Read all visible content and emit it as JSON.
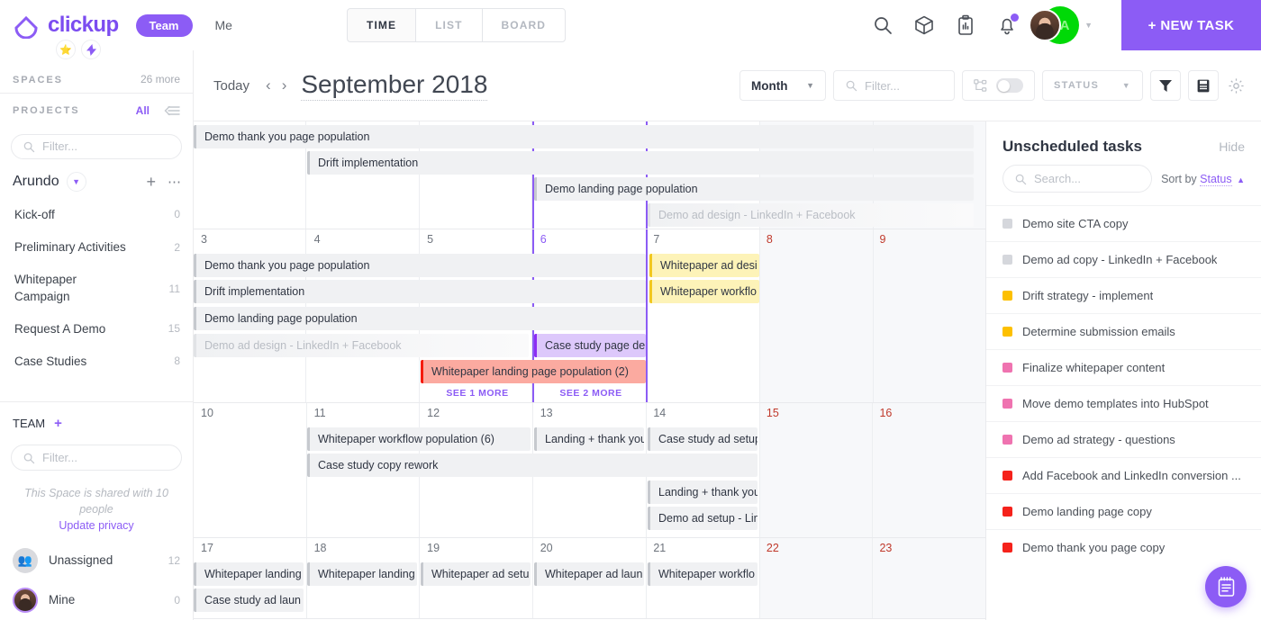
{
  "brand": {
    "name": "clickup",
    "accent": "#8c5cf5"
  },
  "topbar": {
    "team_pill": "Team",
    "me": "Me",
    "tabs": [
      {
        "label": "TIME",
        "active": true
      },
      {
        "label": "LIST",
        "active": false
      },
      {
        "label": "BOARD",
        "active": false
      }
    ],
    "icons": [
      "search-icon",
      "box-icon",
      "clipboard-icon",
      "bell-icon"
    ],
    "avatar_initial": "A",
    "new_task": "+ NEW TASK"
  },
  "sidebar": {
    "spaces_label": "SPACES",
    "spaces_more": "26 more",
    "projects_label": "PROJECTS",
    "projects_all": "All",
    "filter_placeholder": "Filter...",
    "space_name": "Arundo",
    "projects": [
      {
        "label": "Kick-off",
        "count": "0"
      },
      {
        "label": "Preliminary Activities",
        "count": "2"
      },
      {
        "label": "Whitepaper Campaign",
        "count": "11"
      },
      {
        "label": "Request A Demo",
        "count": "15"
      },
      {
        "label": "Case Studies",
        "count": "8"
      }
    ],
    "team_label": "TEAM",
    "team_filter_placeholder": "Filter...",
    "shared_note": "This Space is shared with 10 people",
    "update_privacy": "Update privacy",
    "members": [
      {
        "label": "Unassigned",
        "count": "12",
        "avatar": "group-icon"
      },
      {
        "label": "Mine",
        "count": "0",
        "avatar": "user-photo"
      }
    ]
  },
  "toolbar": {
    "today": "Today",
    "prev": "‹",
    "next": "›",
    "title": "September 2018",
    "view_mode": "Month",
    "filter_placeholder": "Filter...",
    "status_label": "STATUS",
    "icons": [
      "subtasks-icon",
      "filter-icon",
      "save-icon",
      "gear-icon"
    ]
  },
  "calendar": {
    "overflow_events": [
      {
        "label": "Demo thank you page population",
        "start": 0,
        "span": 6,
        "style": "grey",
        "row": 0
      },
      {
        "label": "Drift implementation",
        "start": 1,
        "span": 6,
        "style": "grey",
        "row": 1
      },
      {
        "label": "Demo landing page population",
        "start": 3,
        "span": 4,
        "style": "grey",
        "row": 2
      },
      {
        "label": "Demo ad design - LinkedIn + Facebook",
        "start": 4,
        "span": 3,
        "style": "greyfade",
        "row": 3
      }
    ],
    "weeks": [
      {
        "days": [
          {
            "num": "3",
            "weekend": false,
            "today": false
          },
          {
            "num": "4",
            "weekend": false,
            "today": false
          },
          {
            "num": "5",
            "weekend": false,
            "today": false
          },
          {
            "num": "6",
            "weekend": false,
            "today": true
          },
          {
            "num": "7",
            "weekend": false,
            "today": false
          },
          {
            "num": "8",
            "weekend": true,
            "today": false
          },
          {
            "num": "9",
            "weekend": true,
            "today": false
          }
        ],
        "events": [
          {
            "label": "Demo thank you page population",
            "start": 0,
            "span": 4,
            "row": 0,
            "style": "grey"
          },
          {
            "label": "Drift implementation",
            "start": 0,
            "span": 4,
            "row": 1,
            "style": "grey"
          },
          {
            "label": "Demo landing page population",
            "start": 0,
            "span": 4,
            "row": 2,
            "style": "grey"
          },
          {
            "label": "Demo ad design - LinkedIn + Facebook",
            "start": 0,
            "span": 3,
            "row": 3,
            "style": "greyfade"
          },
          {
            "label": "Case study page de",
            "start": 3,
            "span": 1,
            "row": 3,
            "style": "purple"
          },
          {
            "label": "Whitepaper landing page population (2)",
            "start": 2,
            "span": 2,
            "row": 4,
            "style": "pink"
          },
          {
            "label": "Whitepaper ad desi",
            "start": 4,
            "span": 1,
            "row": 0,
            "style": "yellow"
          },
          {
            "label": "Whitepaper workflo",
            "start": 4,
            "span": 1,
            "row": 1,
            "style": "yellow"
          }
        ],
        "more_links": [
          {
            "label": "SEE 1 MORE",
            "col": 2
          },
          {
            "label": "SEE 2 MORE",
            "col": 3
          }
        ]
      },
      {
        "days": [
          {
            "num": "10",
            "weekend": false,
            "today": false
          },
          {
            "num": "11",
            "weekend": false,
            "today": false
          },
          {
            "num": "12",
            "weekend": false,
            "today": false
          },
          {
            "num": "13",
            "weekend": false,
            "today": false
          },
          {
            "num": "14",
            "weekend": false,
            "today": false
          },
          {
            "num": "15",
            "weekend": true,
            "today": false
          },
          {
            "num": "16",
            "weekend": true,
            "today": false
          }
        ],
        "events": [
          {
            "label": "Whitepaper workflow population (6)",
            "start": 1,
            "span": 2,
            "row": 0,
            "style": "grey"
          },
          {
            "label": "Landing + thank you",
            "start": 3,
            "span": 1,
            "row": 0,
            "style": "grey"
          },
          {
            "label": "Case study ad setup",
            "start": 4,
            "span": 1,
            "row": 0,
            "style": "grey"
          },
          {
            "label": "Case study copy rework",
            "start": 1,
            "span": 4,
            "row": 1,
            "style": "grey"
          },
          {
            "label": "Landing + thank you",
            "start": 4,
            "span": 1,
            "row": 3,
            "style": "grey"
          },
          {
            "label": "Demo ad setup - Lin",
            "start": 4,
            "span": 1,
            "row": 4,
            "style": "grey"
          }
        ],
        "more_links": []
      },
      {
        "days": [
          {
            "num": "17",
            "weekend": false,
            "today": false
          },
          {
            "num": "18",
            "weekend": false,
            "today": false
          },
          {
            "num": "19",
            "weekend": false,
            "today": false
          },
          {
            "num": "20",
            "weekend": false,
            "today": false
          },
          {
            "num": "21",
            "weekend": false,
            "today": false
          },
          {
            "num": "22",
            "weekend": true,
            "today": false
          },
          {
            "num": "23",
            "weekend": true,
            "today": false
          }
        ],
        "events": [
          {
            "label": "Whitepaper landing",
            "start": 0,
            "span": 1,
            "row": 0,
            "style": "grey"
          },
          {
            "label": "Whitepaper landing",
            "start": 1,
            "span": 1,
            "row": 0,
            "style": "grey"
          },
          {
            "label": "Whitepaper ad setu",
            "start": 2,
            "span": 1,
            "row": 0,
            "style": "grey"
          },
          {
            "label": "Whitepaper ad laun",
            "start": 3,
            "span": 1,
            "row": 0,
            "style": "grey"
          },
          {
            "label": "Whitepaper workflo",
            "start": 4,
            "span": 1,
            "row": 0,
            "style": "grey"
          },
          {
            "label": "Case study ad laun",
            "start": 0,
            "span": 1,
            "row": 1,
            "style": "grey"
          }
        ],
        "more_links": []
      }
    ]
  },
  "unscheduled": {
    "title": "Unscheduled tasks",
    "hide": "Hide",
    "search_placeholder": "Search...",
    "sort_prefix": "Sort by",
    "sort_value": "Status",
    "tasks": [
      {
        "label": "Demo site CTA copy",
        "color": "#d5d7dc"
      },
      {
        "label": "Demo ad copy - LinkedIn + Facebook",
        "color": "#d5d7dc"
      },
      {
        "label": "Drift strategy - implement",
        "color": "#fdc000"
      },
      {
        "label": "Determine submission emails",
        "color": "#fdc000"
      },
      {
        "label": "Finalize whitepaper content",
        "color": "#ef73b0"
      },
      {
        "label": "Move demo templates into HubSpot",
        "color": "#ef73b0"
      },
      {
        "label": "Demo ad strategy - questions",
        "color": "#ef73b0"
      },
      {
        "label": "Add Facebook and LinkedIn conversion ...",
        "color": "#f5221b"
      },
      {
        "label": "Demo landing page copy",
        "color": "#f5221b"
      },
      {
        "label": "Demo thank you page copy",
        "color": "#f5221b"
      }
    ],
    "fab_icon": "notepad-icon"
  }
}
